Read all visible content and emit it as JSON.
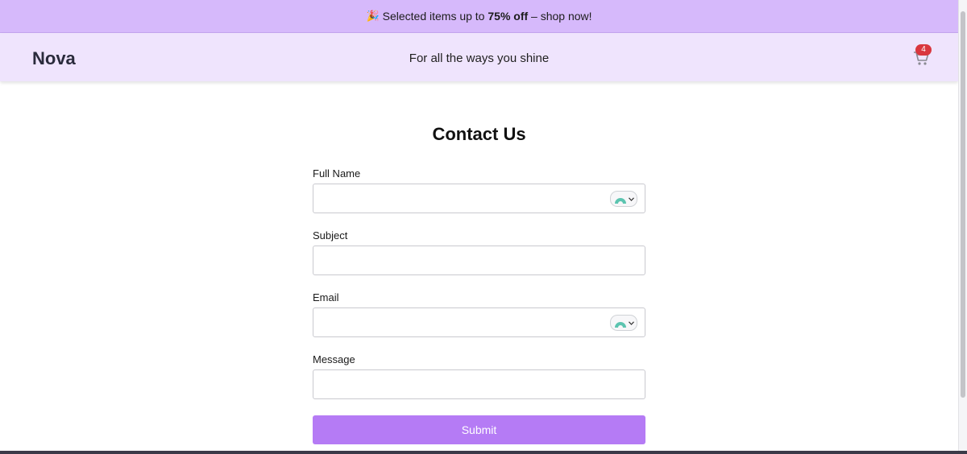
{
  "promo": {
    "emoji": "🎉",
    "text_before": "Selected items up to ",
    "highlight": "75% off",
    "text_after": " – shop now!"
  },
  "header": {
    "logo": "Nova",
    "tagline": "For all the ways you shine",
    "cart_icon": "cart-icon",
    "cart_count": "4"
  },
  "form": {
    "title": "Contact Us",
    "fields": [
      {
        "label": "Full Name",
        "value": "",
        "autofill": true
      },
      {
        "label": "Subject",
        "value": "",
        "autofill": false
      },
      {
        "label": "Email",
        "value": "",
        "autofill": true
      },
      {
        "label": "Message",
        "value": "",
        "autofill": false
      }
    ],
    "submit_label": "Submit"
  },
  "colors": {
    "promo_bg": "#d6b9fb",
    "header_bg": "#efe4fd",
    "accent": "#b57bf5",
    "badge": "#d9363e"
  }
}
